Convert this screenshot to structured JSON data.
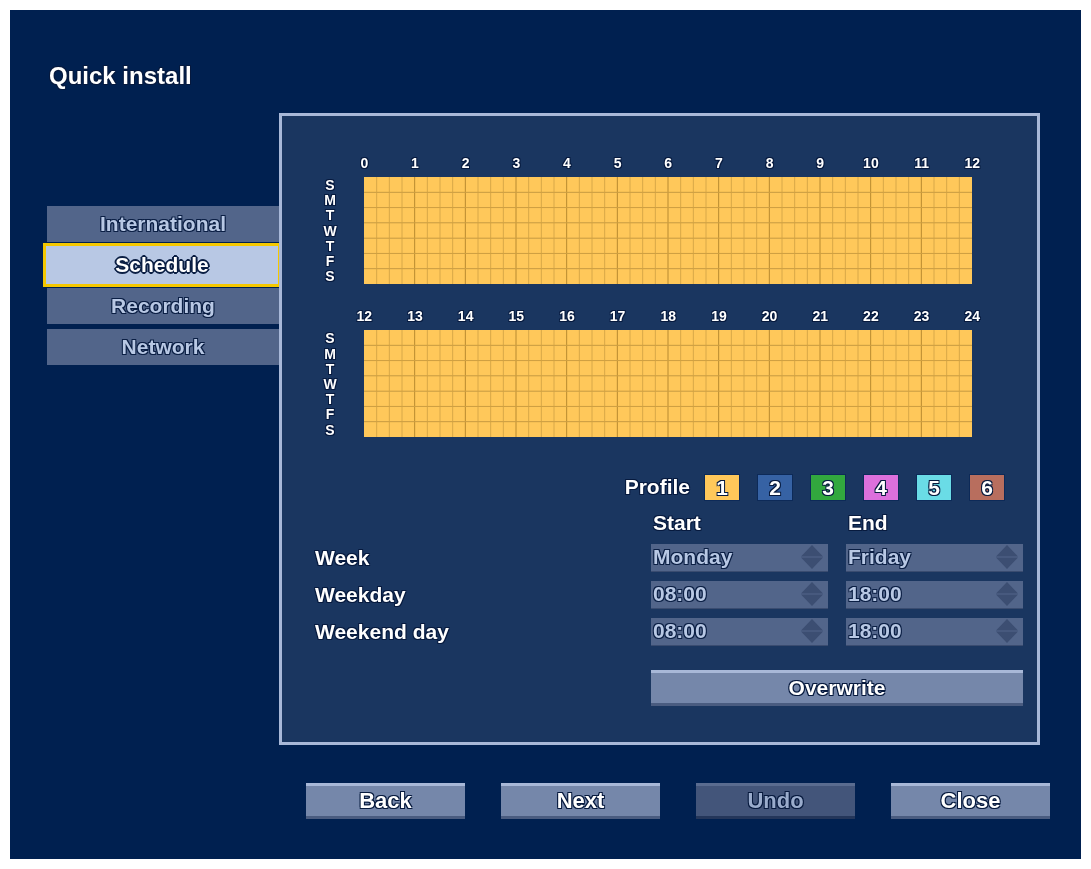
{
  "window": {
    "title": "Quick install"
  },
  "tabs": [
    {
      "label": "International",
      "selected": false
    },
    {
      "label": "Schedule",
      "selected": true
    },
    {
      "label": "Recording",
      "selected": false
    },
    {
      "label": "Network",
      "selected": false
    }
  ],
  "schedule": [
    {
      "hours": [
        "0",
        "1",
        "2",
        "3",
        "4",
        "5",
        "6",
        "7",
        "8",
        "9",
        "10",
        "11",
        "12"
      ],
      "days": [
        {
          "label": "S",
          "color": "#ffc85a"
        },
        {
          "label": "M",
          "color": "#ffc85a"
        },
        {
          "label": "T",
          "color": "#ffc85a"
        },
        {
          "label": "W",
          "color": "#ffc85a"
        },
        {
          "label": "T",
          "color": "#ffc85a"
        },
        {
          "label": "F",
          "color": "#ffc85a"
        },
        {
          "label": "S",
          "color": "#ffc85a"
        }
      ]
    },
    {
      "hours": [
        "12",
        "13",
        "14",
        "15",
        "16",
        "17",
        "18",
        "19",
        "20",
        "21",
        "22",
        "23",
        "24"
      ],
      "days": [
        {
          "label": "S",
          "color": "#ffc85a"
        },
        {
          "label": "M",
          "color": "#ffc85a"
        },
        {
          "label": "T",
          "color": "#ffc85a"
        },
        {
          "label": "W",
          "color": "#ffc85a"
        },
        {
          "label": "T",
          "color": "#ffc85a"
        },
        {
          "label": "F",
          "color": "#ffc85a"
        },
        {
          "label": "S",
          "color": "#ffc85a"
        }
      ]
    }
  ],
  "profile": {
    "label": "Profile",
    "profiles": [
      {
        "label": "1",
        "color": "#ffc85a"
      },
      {
        "label": "2",
        "color": "#3662a4"
      },
      {
        "label": "3",
        "color": "#32a83e"
      },
      {
        "label": "4",
        "color": "#dc70dc"
      },
      {
        "label": "5",
        "color": "#6adce6"
      },
      {
        "label": "6",
        "color": "#b86e5e"
      }
    ]
  },
  "form": {
    "columns": [
      "Start",
      "End"
    ],
    "rows": [
      {
        "label": "Week",
        "start": "Monday",
        "end": "Friday"
      },
      {
        "label": "Weekday",
        "start": "08:00",
        "end": "18:00"
      },
      {
        "label": "Weekend day",
        "start": "08:00",
        "end": "18:00"
      }
    ],
    "action": "Overwrite"
  },
  "buttons": [
    {
      "label": "Back",
      "disabled": false
    },
    {
      "label": "Next",
      "disabled": false
    },
    {
      "label": "Undo",
      "disabled": true
    },
    {
      "label": "Close",
      "disabled": false
    }
  ]
}
